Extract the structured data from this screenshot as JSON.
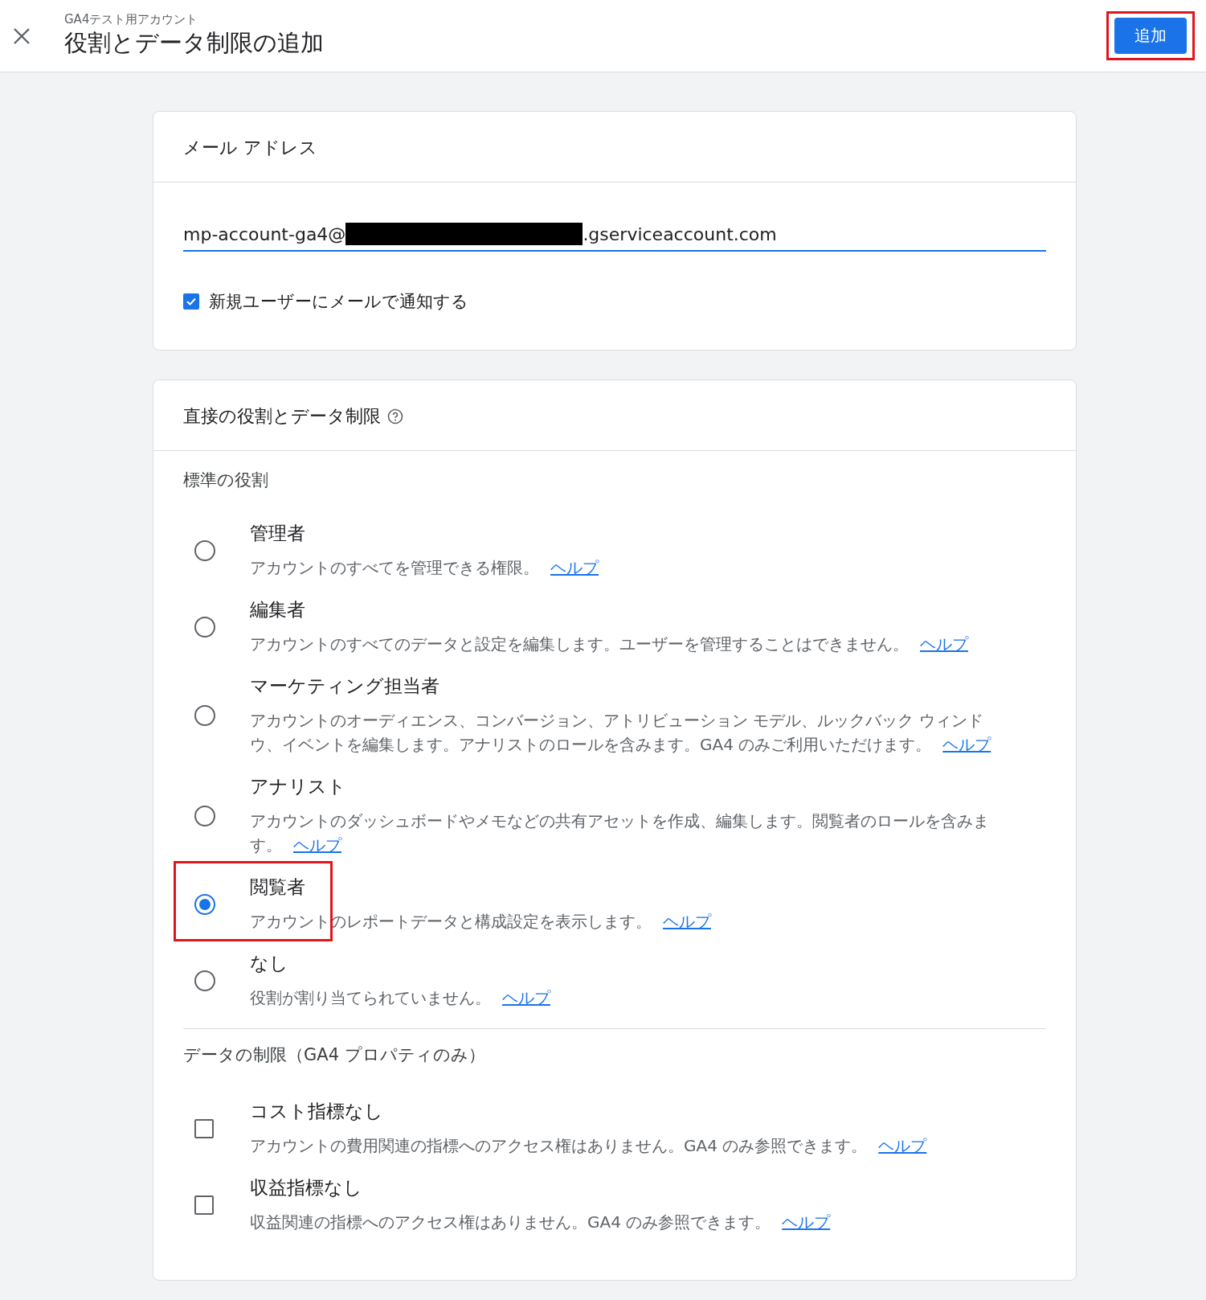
{
  "header": {
    "account": "GA4テスト用アカウント",
    "title": "役割とデータ制限の追加",
    "add_button": {
      "label": "追加",
      "highlighted": true
    }
  },
  "email_card": {
    "title": "メール アドレス",
    "email_prefix": "mp-account-ga4@",
    "email_suffix": ".gserviceaccount.com",
    "notify": {
      "label": "新規ユーザーにメールで通知する",
      "checked": true
    }
  },
  "roles_card": {
    "title": "直接の役割とデータ制限",
    "section_label": "標準の役割",
    "roles": [
      {
        "name": "管理者",
        "description": "アカウントのすべてを管理できる権限。",
        "help": "ヘルプ",
        "selected": false,
        "highlighted": false
      },
      {
        "name": "編集者",
        "description": "アカウントのすべてのデータと設定を編集します。ユーザーを管理することはできません。",
        "help": "ヘルプ",
        "selected": false,
        "highlighted": false
      },
      {
        "name": "マーケティング担当者",
        "description": "アカウントのオーディエンス、コンバージョン、アトリビューション モデル、ルックバック ウィンドウ、イベントを編集します。アナリストのロールを含みます。GA4 のみご利用いただけます。",
        "help": "ヘルプ",
        "selected": false,
        "highlighted": false
      },
      {
        "name": "アナリスト",
        "description": "アカウントのダッシュボードやメモなどの共有アセットを作成、編集します。閲覧者のロールを含みます。",
        "help": "ヘルプ",
        "selected": false,
        "highlighted": false
      },
      {
        "name": "閲覧者",
        "description": "アカウントのレポートデータと構成設定を表示します。",
        "help": "ヘルプ",
        "selected": true,
        "highlighted": true
      },
      {
        "name": "なし",
        "description": "役割が割り当てられていません。",
        "help": "ヘルプ",
        "selected": false,
        "highlighted": false
      }
    ],
    "restrictions_label": "データの制限（GA4 プロパティのみ）",
    "restrictions": [
      {
        "name": "コスト指標なし",
        "description": "アカウントの費用関連の指標へのアクセス権はありません。GA4 のみ参照できます。",
        "help": "ヘルプ",
        "checked": false
      },
      {
        "name": "収益指標なし",
        "description": "収益関連の指標へのアクセス権はありません。GA4 のみ参照できます。",
        "help": "ヘルプ",
        "checked": false
      }
    ]
  }
}
